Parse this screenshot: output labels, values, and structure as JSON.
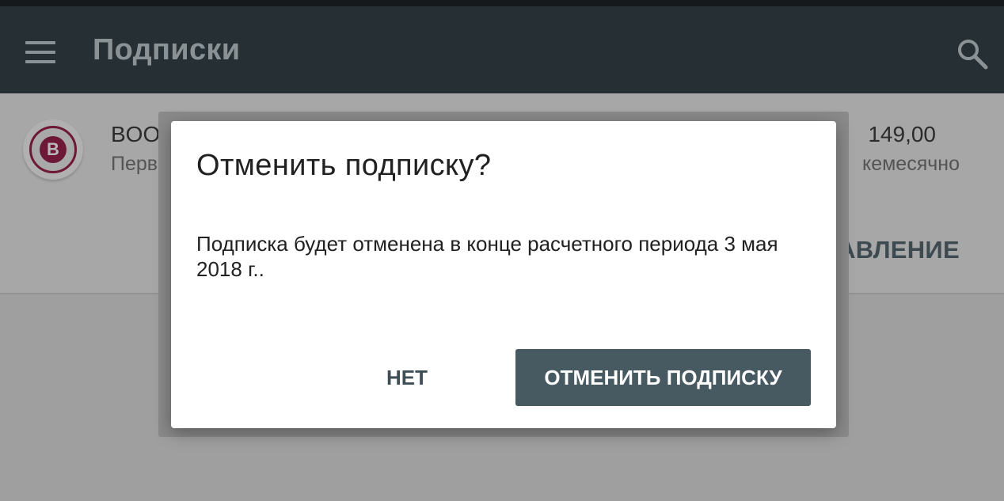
{
  "app_bar": {
    "title": "Подписки",
    "menu_icon": "menu-icon",
    "search_icon": "search-icon",
    "background": "#263034"
  },
  "subscription": {
    "name": "BOO",
    "detail": "Перв",
    "price": "149,00",
    "period": "кемесячно",
    "manage_label": "АВЛЕНИЕ",
    "logo_letter": "B",
    "logo_color": "#6e1837"
  },
  "dialog": {
    "title": "Отменить подписку?",
    "message": "Подписка будет отменена в конце расчетного периода 3 мая 2018 г..",
    "negative_label": "НЕТ",
    "positive_label": "ОТМЕНИТЬ ПОДПИСКУ",
    "positive_color": "#475961"
  }
}
